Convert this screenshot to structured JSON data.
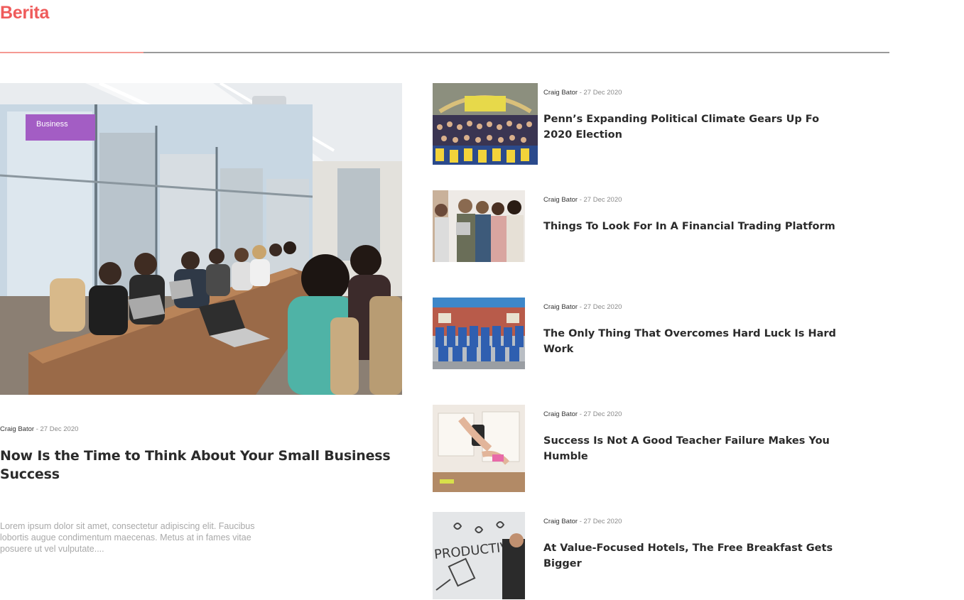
{
  "section": {
    "title": "Berita"
  },
  "colors": {
    "accent": "#ef5b5b",
    "badge": "#a35dc4",
    "divider": "#9a9a9a"
  },
  "featured": {
    "category": "Business",
    "author": "Craig Bator",
    "separator": " - ",
    "date": "27 Dec 2020",
    "title": "Now Is the Time to Think About Your Small  Business Success",
    "excerpt": "Lorem ipsum dolor sit amet, consectetur adipiscing elit. Faucibus lobortis augue condimentum maecenas. Metus at in fames vitae posuere ut vel vulputate...."
  },
  "articles": [
    {
      "author": "Craig Bator",
      "separator": " - ",
      "date": "27 Dec 2020",
      "title": "Penn’s Expanding Political Climate Gears Up Fo 2020 Election",
      "image": "crowd-photo"
    },
    {
      "author": "Craig Bator",
      "separator": " - ",
      "date": "27 Dec 2020",
      "title": "Things To Look For In A Financial Trading Platform",
      "image": "team-photo"
    },
    {
      "author": "Craig Bator",
      "separator": " - ",
      "date": "27 Dec 2020",
      "title": "The Only Thing That Overcomes Hard Luck Is Hard Work",
      "image": "group-photo"
    },
    {
      "author": "Craig Bator",
      "separator": " - ",
      "date": "27 Dec 2020",
      "title": "Success Is Not A Good Teacher Failure Makes You Humble",
      "image": "desk-photo"
    },
    {
      "author": "Craig Bator",
      "separator": " - ",
      "date": "27 Dec 2020",
      "title": "At Value-Focused Hotels, The Free Breakfast Gets Bigger",
      "image": "productivity-photo"
    }
  ]
}
